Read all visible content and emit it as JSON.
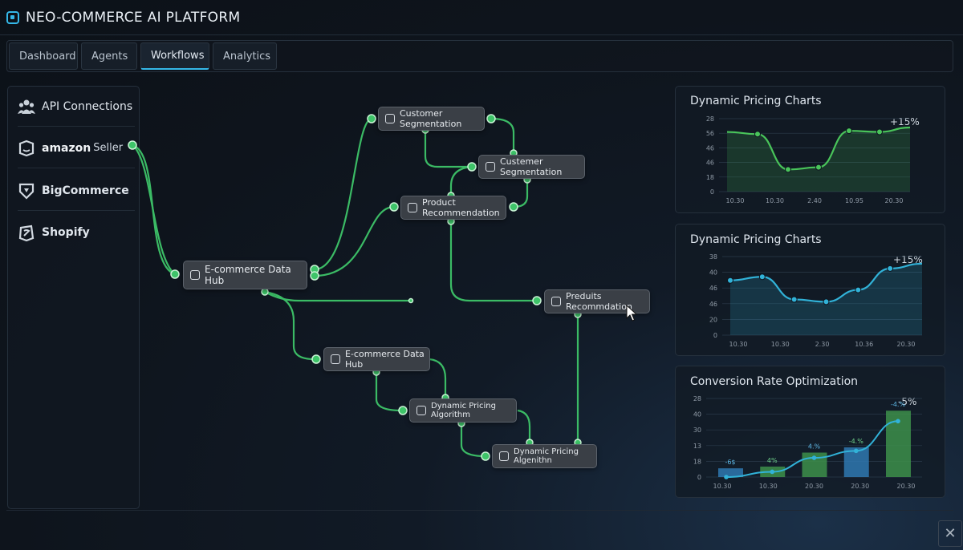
{
  "app": {
    "title": "NEO-COMMERCE AI PLATFORM"
  },
  "tabs": [
    {
      "label": "Dashboard"
    },
    {
      "label": "Agents"
    },
    {
      "label": "Workflows",
      "active": true
    },
    {
      "label": "Analytics"
    }
  ],
  "sidebar": {
    "items": [
      {
        "label": "API Connections",
        "icon": "users-icon"
      },
      {
        "brand": "amazon",
        "label": "Seller",
        "icon": "amazon-icon"
      },
      {
        "label": "BigCommerce",
        "icon": "bigcommerce-icon"
      },
      {
        "label": "Shopify",
        "icon": "shopify-icon"
      }
    ]
  },
  "workflow": {
    "nodes": [
      {
        "id": "n1",
        "label": "Customer Segmentation"
      },
      {
        "id": "n2",
        "label": "Custemer Segmentation"
      },
      {
        "id": "n3",
        "label": "Product Recommendation"
      },
      {
        "id": "n4",
        "label": "E-commerce Data Hub"
      },
      {
        "id": "n5",
        "label": "Preduits Recommdation"
      },
      {
        "id": "n6",
        "label": "E-commerce Data Hub"
      },
      {
        "id": "n7",
        "label": "Dynamic Pricing Algorithm"
      },
      {
        "id": "n8",
        "label": "Dynamic Pricing Algenithn"
      }
    ],
    "colors": {
      "edge": "#3ec469",
      "node": "#3a3f46"
    }
  },
  "chart_data": [
    {
      "type": "area",
      "title": "Dynamic Pricing Charts",
      "annotation": "+15%",
      "x": [
        "10.30",
        "10.30",
        "2.40",
        "10.95",
        "20.30"
      ],
      "y_ticks": [
        "28",
        "56",
        "46",
        "46",
        "18",
        "0"
      ],
      "series": [
        {
          "values": [
            54,
            52,
            20,
            22,
            55,
            54,
            58
          ],
          "color": "#49c45a"
        }
      ]
    },
    {
      "type": "area",
      "title": "Dynamic Pricing Charts",
      "annotation": "+15%",
      "x": [
        "10.30",
        "10.30",
        "2.30",
        "10.36",
        "20.30"
      ],
      "y_ticks": [
        "38",
        "40",
        "46",
        "46",
        "20",
        "0"
      ],
      "series": [
        {
          "values": [
            46,
            49,
            30,
            28,
            38,
            56,
            60
          ],
          "color": "#31b2d8"
        }
      ]
    },
    {
      "type": "bar",
      "title": "Conversion Rate Optimization",
      "annotation": "-5%",
      "categories": [
        "10.30",
        "10.30",
        "20.30",
        "20.30",
        "20.30"
      ],
      "y_ticks": [
        "28",
        "40",
        "30",
        "13",
        "18",
        "0"
      ],
      "values": [
        5,
        6,
        14,
        17,
        38
      ],
      "bar_labels": [
        "-6$",
        "4%",
        "4.%",
        "-4.%",
        "-4.%"
      ],
      "colors": [
        "#2f78b0",
        "#3d8f4a",
        "#3d8f4a",
        "#2f78b0",
        "#3d8f4a"
      ],
      "trend": [
        0,
        3,
        11,
        15,
        32
      ]
    }
  ],
  "controls": {
    "close_symbol": "✕"
  }
}
